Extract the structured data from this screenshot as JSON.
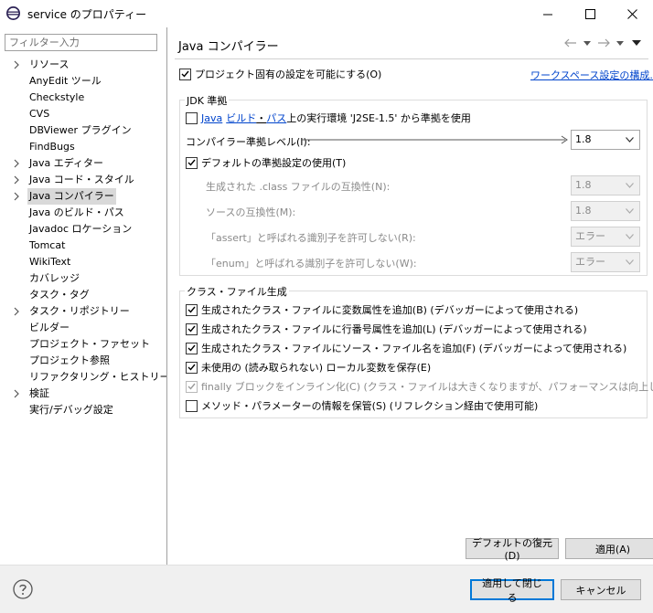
{
  "window": {
    "title": "service のプロパティー",
    "minimize_icon": "minimize-icon",
    "maximize_icon": "maximize-icon",
    "close_icon": "close-icon"
  },
  "sidebar": {
    "filter_placeholder": "フィルター入力",
    "items": [
      {
        "label": "リソース",
        "expandable": true
      },
      {
        "label": "AnyEdit ツール",
        "expandable": false
      },
      {
        "label": "Checkstyle",
        "expandable": false
      },
      {
        "label": "CVS",
        "expandable": false
      },
      {
        "label": "DBViewer プラグイン",
        "expandable": false
      },
      {
        "label": "FindBugs",
        "expandable": false
      },
      {
        "label": "Java エディター",
        "expandable": true
      },
      {
        "label": "Java コード・スタイル",
        "expandable": true
      },
      {
        "label": "Java コンパイラー",
        "expandable": true,
        "selected": true
      },
      {
        "label": "Java のビルド・パス",
        "expandable": false
      },
      {
        "label": "Javadoc ロケーション",
        "expandable": false
      },
      {
        "label": "Tomcat",
        "expandable": false
      },
      {
        "label": "WikiText",
        "expandable": false
      },
      {
        "label": "カバレッジ",
        "expandable": false
      },
      {
        "label": "タスク・タグ",
        "expandable": false
      },
      {
        "label": "タスク・リポジトリー",
        "expandable": true
      },
      {
        "label": "ビルダー",
        "expandable": false
      },
      {
        "label": "プロジェクト・ファセット",
        "expandable": false
      },
      {
        "label": "プロジェクト参照",
        "expandable": false
      },
      {
        "label": "リファクタリング・ヒストリー",
        "expandable": false
      },
      {
        "label": "検証",
        "expandable": true
      },
      {
        "label": "実行/デバッグ設定",
        "expandable": false
      }
    ]
  },
  "page": {
    "title": "Java コンパイラー",
    "nav_icons": [
      "back-arrow-icon",
      "dropdown-icon",
      "forward-arrow-icon",
      "dropdown-icon",
      "view-menu-icon"
    ],
    "enable_project_specific": {
      "label": "プロジェクト固有の設定を可能にする(O)",
      "checked": true
    },
    "workspace_link": "ワークスペース設定の構成...",
    "jdk_group": {
      "title": "JDK 準拠",
      "build_path_row": {
        "link1": "Java",
        "link2": "ビルド",
        "link3": "パス",
        "rest": "上の実行環境 'J2SE-1.5' から準拠を使用",
        "checked": false
      },
      "compliance_level": {
        "label": "コンパイラー準拠レベル(I):",
        "value": "1.8"
      },
      "use_default": {
        "label": "デフォルトの準拠設定の使用(T)",
        "checked": true
      },
      "class_compat": {
        "label": "生成された .class ファイルの互換性(N):",
        "value": "1.8"
      },
      "source_compat": {
        "label": "ソースの互換性(M):",
        "value": "1.8"
      },
      "assert_ident": {
        "label": "「assert」と呼ばれる識別子を許可しない(R):",
        "value": "エラー"
      },
      "enum_ident": {
        "label": "「enum」と呼ばれる識別子を許可しない(W):",
        "value": "エラー"
      }
    },
    "classfile_group": {
      "title": "クラス・ファイル生成",
      "options": [
        {
          "label": "生成されたクラス・ファイルに変数属性を追加(B) (デバッガーによって使用される)",
          "checked": true,
          "disabled": false
        },
        {
          "label": "生成されたクラス・ファイルに行番号属性を追加(L) (デバッガーによって使用される)",
          "checked": true,
          "disabled": false
        },
        {
          "label": "生成されたクラス・ファイルにソース・ファイル名を追加(F) (デバッガーによって使用される)",
          "checked": true,
          "disabled": false
        },
        {
          "label": "未使用の (読み取られない) ローカル変数を保存(E)",
          "checked": true,
          "disabled": false
        },
        {
          "label": "finally ブロックをインライン化(C) (クラス・ファイルは大きくなりますが、パフォーマンスは向上します)",
          "checked": true,
          "disabled": true
        },
        {
          "label": "メソッド・パラメーターの情報を保管(S) (リフレクション経由で使用可能)",
          "checked": false,
          "disabled": false
        }
      ]
    },
    "restore_defaults": "デフォルトの復元(D)",
    "apply": "適用(A)"
  },
  "footer": {
    "help_icon": "help-icon",
    "apply_close": "適用して閉じる",
    "cancel": "キャンセル"
  }
}
